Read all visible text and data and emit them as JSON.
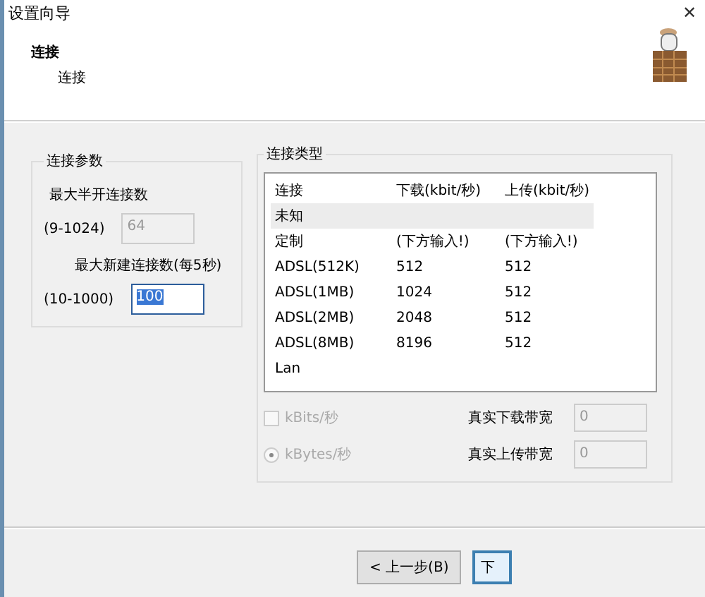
{
  "window": {
    "title": "设置向导",
    "close": "✕"
  },
  "header": {
    "title": "连接",
    "subtitle": "连接"
  },
  "params": {
    "title": "连接参数",
    "half_open_label": "最大半开连接数",
    "half_open_range": "(9-1024)",
    "half_open_value": "64",
    "half_open_disabled": true,
    "new_conn_label": "最大新建连接数(每5秒)",
    "new_conn_range": "(10-1000)",
    "new_conn_value": "100",
    "new_conn_disabled": false
  },
  "conn_type": {
    "title": "连接类型",
    "columns": [
      "连接",
      "下载(kbit/秒)",
      "上传(kbit/秒)"
    ],
    "rows": [
      {
        "cells": [
          "未知",
          "",
          ""
        ],
        "selected": true
      },
      {
        "cells": [
          "定制",
          "(下方输入!)",
          "(下方输入!)"
        ],
        "selected": false
      },
      {
        "cells": [
          "ADSL(512K)",
          "512",
          "512"
        ],
        "selected": false
      },
      {
        "cells": [
          "ADSL(1MB)",
          "1024",
          "512"
        ],
        "selected": false
      },
      {
        "cells": [
          "ADSL(2MB)",
          "2048",
          "512"
        ],
        "selected": false
      },
      {
        "cells": [
          "ADSL(8MB)",
          "8196",
          "512"
        ],
        "selected": false
      },
      {
        "cells": [
          "Lan",
          "",
          ""
        ],
        "selected": false
      }
    ],
    "units": [
      {
        "kind": "checkbox",
        "label": "kBits/秒",
        "checked": false,
        "disabled": true
      },
      {
        "kind": "radio",
        "label": "kBytes/秒",
        "checked": true,
        "disabled": true
      }
    ],
    "bandwidth": [
      {
        "label": "真实下载带宽",
        "value": "0",
        "disabled": true
      },
      {
        "label": "真实上传带宽",
        "value": "0",
        "disabled": true
      }
    ]
  },
  "buttons": [
    {
      "label": "< 上一步(B)",
      "focused": false
    },
    {
      "label": "下",
      "focused": true
    }
  ]
}
